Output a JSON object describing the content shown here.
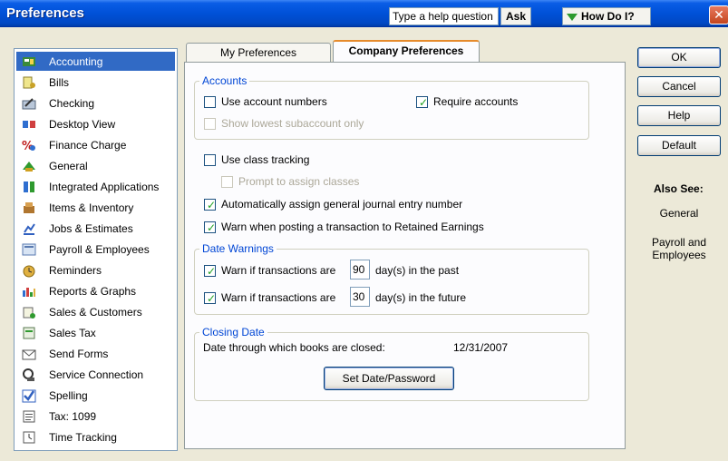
{
  "window": {
    "title": "Preferences",
    "help_placeholder": "Type a help question",
    "ask_label": "Ask",
    "howdoi_label": "How Do I?",
    "close_glyph": "✕"
  },
  "sidebar": {
    "items": [
      {
        "label": "Accounting",
        "icon": "accounting-icon",
        "selected": true
      },
      {
        "label": "Bills",
        "icon": "bills-icon"
      },
      {
        "label": "Checking",
        "icon": "checking-icon"
      },
      {
        "label": "Desktop View",
        "icon": "desktop-view-icon"
      },
      {
        "label": "Finance Charge",
        "icon": "finance-charge-icon"
      },
      {
        "label": "General",
        "icon": "general-icon"
      },
      {
        "label": "Integrated Applications",
        "icon": "integrated-apps-icon"
      },
      {
        "label": "Items & Inventory",
        "icon": "items-inventory-icon"
      },
      {
        "label": "Jobs & Estimates",
        "icon": "jobs-estimates-icon"
      },
      {
        "label": "Payroll & Employees",
        "icon": "payroll-icon"
      },
      {
        "label": "Reminders",
        "icon": "reminders-icon"
      },
      {
        "label": "Reports & Graphs",
        "icon": "reports-graphs-icon"
      },
      {
        "label": "Sales & Customers",
        "icon": "sales-customers-icon"
      },
      {
        "label": "Sales Tax",
        "icon": "sales-tax-icon"
      },
      {
        "label": "Send Forms",
        "icon": "send-forms-icon"
      },
      {
        "label": "Service Connection",
        "icon": "service-connection-icon"
      },
      {
        "label": "Spelling",
        "icon": "spelling-icon"
      },
      {
        "label": "Tax: 1099",
        "icon": "tax-1099-icon"
      },
      {
        "label": "Time Tracking",
        "icon": "time-tracking-icon"
      }
    ]
  },
  "tabs": {
    "my_prefs": "My Preferences",
    "company_prefs": "Company Preferences"
  },
  "accounts": {
    "legend": "Accounts",
    "use_account_numbers": "Use account numbers",
    "require_accounts": "Require accounts",
    "show_lowest": "Show lowest subaccount only"
  },
  "class_tracking": {
    "use_class_tracking": "Use class tracking",
    "prompt_assign": "Prompt to assign classes",
    "auto_assign": "Automatically assign general journal entry number",
    "warn_retained": "Warn when posting a transaction to Retained Earnings"
  },
  "date_warnings": {
    "legend": "Date Warnings",
    "warn_if": "Warn if transactions are",
    "past_value": "90",
    "past_suffix": "day(s) in the past",
    "warn_if_future": "Warn if transactions are",
    "future_value": "30",
    "future_suffix": "day(s) in the future"
  },
  "closing_date": {
    "legend": "Closing Date",
    "label": "Date through which books are closed:",
    "value": "12/31/2007",
    "set_button": "Set Date/Password"
  },
  "buttons": {
    "ok": "OK",
    "cancel": "Cancel",
    "help": "Help",
    "default": "Default"
  },
  "also_see": {
    "title": "Also See:",
    "general": "General",
    "payroll": "Payroll and Employees"
  },
  "colors": {
    "title_bar": "#0051D8",
    "selection": "#316AC5",
    "legend_text": "#0046D5",
    "check": "#21A121",
    "tab_accent": "#E68B2C"
  }
}
